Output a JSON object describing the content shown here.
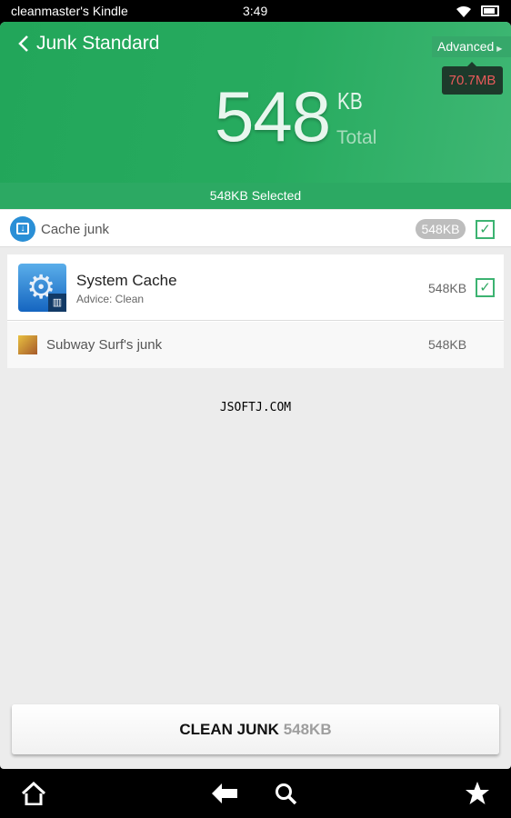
{
  "status_bar": {
    "device_name": "cleanmaster's Kindle",
    "time": "3:49",
    "wifi_icon": "wifi-icon",
    "battery_icon": "battery-icon"
  },
  "header": {
    "title": "Junk Standard",
    "advanced_label": "Advanced",
    "advanced_tooltip": "70.7MB",
    "total_value": "548",
    "total_unit": "KB",
    "total_label": "Total",
    "selected_text": "548KB  Selected",
    "tooltip_text_color": "#e85a5a",
    "brand_green": "#27ab5f"
  },
  "category": {
    "label": "Cache junk",
    "size_badge": "548KB",
    "checked": true
  },
  "items": [
    {
      "title": "System Cache",
      "subtitle": "Advice: Clean",
      "size": "548KB",
      "checked": true
    },
    {
      "title": "Subway Surf's junk",
      "size": "548KB"
    }
  ],
  "watermark": "JSOFTJ.COM",
  "clean_button": {
    "label": "CLEAN JUNK",
    "size": "548KB"
  },
  "nav": {
    "home": "home-icon",
    "back": "back-arrow-icon",
    "search": "search-icon",
    "favorites": "star-icon"
  }
}
